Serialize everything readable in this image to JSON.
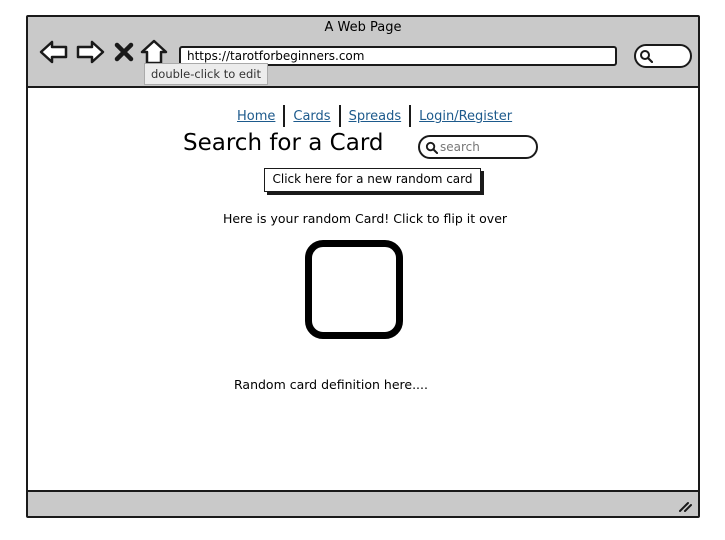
{
  "window": {
    "title": "A Web Page"
  },
  "browser": {
    "url": "https://tarotforbeginners.com",
    "tooltip": "double-click to edit",
    "icons": [
      "back-arrow-icon",
      "forward-arrow-icon",
      "stop-icon",
      "home-icon",
      "search-icon"
    ]
  },
  "nav": {
    "links": [
      "Home",
      "Cards",
      "Spreads",
      "Login/Register"
    ]
  },
  "page": {
    "title": "Search for a Card",
    "search_placeholder": "search",
    "random_button": "Click here for a new random card",
    "hint": "Here is your random Card! Click to flip it over",
    "definition": "Random card definition here...."
  },
  "colors": {
    "chrome": "#c9c9c9",
    "link": "#1d5a8c"
  }
}
